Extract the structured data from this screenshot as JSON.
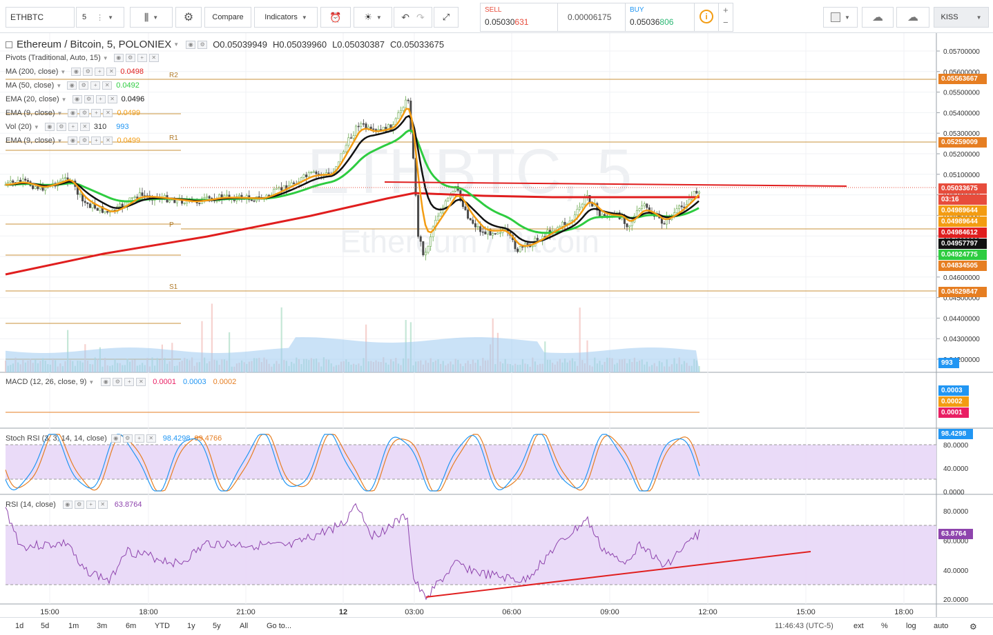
{
  "toolbar": {
    "symbol": "ETHBTC",
    "interval": "5",
    "compare_label": "Compare",
    "indicators_label": "Indicators",
    "sell_label": "SELL",
    "sell_price_a": "0.05030",
    "sell_price_b": "631",
    "spread": "0.00006175",
    "buy_label": "BUY",
    "buy_price_a": "0.05036",
    "buy_price_b": "806",
    "user_label": "KISS"
  },
  "header": {
    "title": "Ethereum / Bitcoin, 5, POLONIEX",
    "open": "O0.05039949",
    "high": "H0.05039960",
    "low": "L0.05030387",
    "close": "C0.05033675"
  },
  "watermark": {
    "symbol": "ETHBTC, 5",
    "name": "Ethereum / Bitcoin"
  },
  "legends": [
    {
      "name": "Pivots (Traditional, Auto, 15)",
      "value": "",
      "color": "#333333"
    },
    {
      "name": "MA (200, close)",
      "value": "0.0498",
      "color": "#e01e1e"
    },
    {
      "name": "MA (50, close)",
      "value": "0.0492",
      "color": "#2ecc40"
    },
    {
      "name": "EMA (20, close)",
      "value": "0.0496",
      "color": "#111111"
    },
    {
      "name": "EMA (9, close)",
      "value": "0.0499",
      "color": "#f39c12"
    },
    {
      "name": "Vol (20)",
      "value": "310",
      "value2": "993",
      "color": "#333333"
    },
    {
      "name": "EMA (9, close)",
      "value": "0.0499",
      "color": "#f39c12"
    }
  ],
  "pivot_labels": [
    "R2",
    "R1",
    "P",
    "S1"
  ],
  "price_axis": [
    "0.05700000",
    "0.05600000",
    "0.05500000",
    "0.05400000",
    "0.05300000",
    "0.05200000",
    "0.05100000",
    "0.05000000",
    "0.04900000",
    "0.04800000",
    "0.04700000",
    "0.04600000",
    "0.04500000",
    "0.04400000",
    "0.04300000",
    "0.04200000"
  ],
  "price_tags": [
    {
      "label": "0.05563667",
      "color": "#e67e22"
    },
    {
      "label": "0.05259009",
      "color": "#e67e22"
    },
    {
      "label": "0.05033675",
      "color": "#e74c3c"
    },
    {
      "label": "03:16",
      "color": "#e74c3c"
    },
    {
      "label": "0.04989644",
      "color": "#f39c12"
    },
    {
      "label": "0.04989644",
      "color": "#f39c12"
    },
    {
      "label": "0.04984612",
      "color": "#e01e1e"
    },
    {
      "label": "0.04957797",
      "color": "#111111"
    },
    {
      "label": "0.04924775",
      "color": "#2ecc40"
    },
    {
      "label": "0.04834505",
      "color": "#e67e22"
    },
    {
      "label": "0.04529847",
      "color": "#e67e22"
    },
    {
      "label": "993",
      "color": "#2196f3"
    }
  ],
  "macd": {
    "name": "MACD (12, 26, close, 9)",
    "v1": "0.0001",
    "v2": "0.0003",
    "v3": "0.0002",
    "tags": [
      {
        "label": "0.0003",
        "color": "#2196f3"
      },
      {
        "label": "0.0002",
        "color": "#f39c12"
      },
      {
        "label": "0.0001",
        "color": "#e91e63"
      }
    ]
  },
  "stoch": {
    "name": "Stoch RSI (3, 3, 14, 14, close)",
    "v1": "98.4298",
    "v2": "99.4766",
    "axis": [
      "80.0000",
      "40.0000",
      "0.0000"
    ],
    "tag": "98.4298"
  },
  "rsi": {
    "name": "RSI (14, close)",
    "v1": "63.8764",
    "axis": [
      "80.0000",
      "60.0000",
      "40.0000",
      "20.0000"
    ],
    "tag": "63.8764"
  },
  "time_axis": [
    "15:00",
    "18:00",
    "21:00",
    "12",
    "03:00",
    "06:00",
    "09:00",
    "12:00",
    "15:00",
    "18:00"
  ],
  "bottom": {
    "ranges": [
      "1d",
      "5d",
      "1m",
      "3m",
      "6m",
      "YTD",
      "1y",
      "5y",
      "All"
    ],
    "goto": "Go to...",
    "clock": "11:46:43 (UTC-5)",
    "ext": "ext",
    "pct": "%",
    "log": "log",
    "auto": "auto"
  },
  "colors": {
    "ma200": "#e01e1e",
    "ma50": "#2ecc40",
    "ema20": "#111111",
    "ema9": "#f39c12",
    "pivot": "#c8923a",
    "stoch_k": "#2196f3",
    "stoch_d": "#e67e22",
    "rsi": "#8e44ad",
    "band": "#e8d7f7"
  }
}
